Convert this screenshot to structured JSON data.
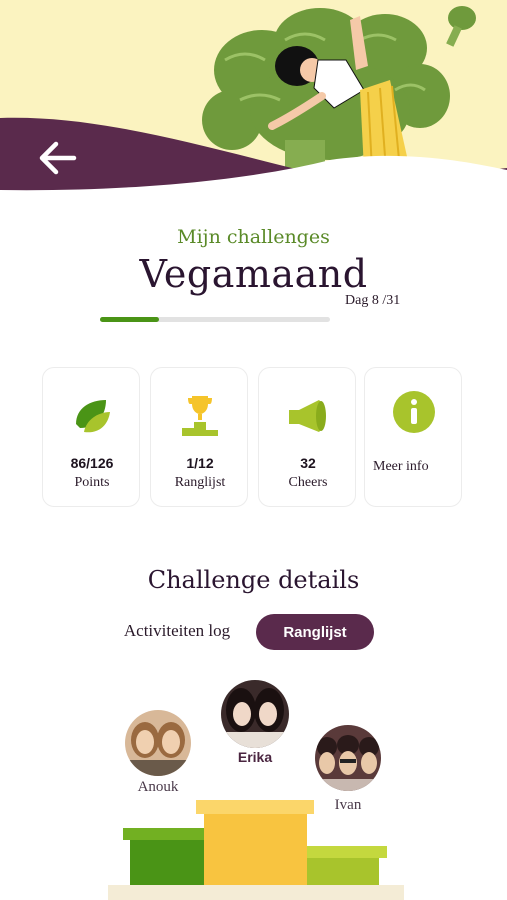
{
  "header": {
    "back_icon": "arrow-left-icon",
    "colors": {
      "banner": "#fbf3c0",
      "wave": "#5a2a4c",
      "broccoli": "#6f9a3c"
    }
  },
  "challenge": {
    "subtitle": "Mijn challenges",
    "title": "Vegamaand",
    "day_label": "Dag 8 /31",
    "day_current": 8,
    "day_total": 31
  },
  "stats": [
    {
      "icon": "leaf-icon",
      "value": "86/126",
      "label": "Points"
    },
    {
      "icon": "trophy-podium-icon",
      "value": "1/12",
      "label": "Ranglijst"
    },
    {
      "icon": "megaphone-icon",
      "value": "32",
      "label": "Cheers"
    },
    {
      "icon": "info-icon",
      "value": "",
      "label": "Meer info"
    }
  ],
  "details": {
    "title": "Challenge details",
    "tabs": [
      {
        "label": "Activiteiten log",
        "active": false
      },
      {
        "label": "Ranglijst",
        "active": true
      }
    ]
  },
  "podium": {
    "first": {
      "name": "Erika",
      "place": 1
    },
    "second": {
      "name": "Anouk",
      "place": 2
    },
    "third": {
      "name": "Ivan",
      "place": 3
    },
    "colors": {
      "first": "#f8c440",
      "second": "#4a9416",
      "third": "#a8c42c"
    }
  }
}
